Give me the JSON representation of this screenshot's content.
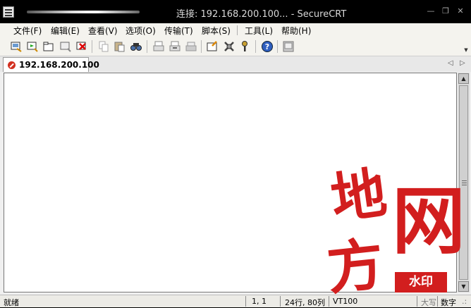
{
  "window": {
    "title": "连接: 192.168.200.100... - SecureCRT",
    "controls": [
      "minimize",
      "restore",
      "close"
    ]
  },
  "menu": [
    {
      "label": "文件(F)"
    },
    {
      "label": "编辑(E)"
    },
    {
      "label": "查看(V)"
    },
    {
      "label": "选项(O)"
    },
    {
      "label": "传输(T)"
    },
    {
      "label": "脚本(S)"
    },
    {
      "label": "工具(L)"
    },
    {
      "label": "帮助(H)"
    }
  ],
  "toolbar": {
    "buttons": [
      "connect-icon",
      "quick-connect-icon",
      "connect-in-tab-icon",
      "reconnect-icon",
      "disconnect-icon",
      "copy-icon",
      "paste-icon",
      "find-icon",
      "print-icon",
      "print-selection-icon",
      "printer-icon",
      "session-options-icon",
      "global-options-icon",
      "keymap-icon",
      "help-icon",
      "screenshot-icon"
    ]
  },
  "tabs": [
    {
      "label": "192.168.200.100",
      "status": "disconnected",
      "status_color": "#d23020"
    }
  ],
  "watermark": {
    "chars": [
      "地",
      "网",
      "方"
    ],
    "badge": "水印",
    "color": "#d21e1e"
  },
  "statusbar": {
    "ready": "就绪",
    "position": "1,  1",
    "size": "24行, 80列",
    "terminal": "VT100",
    "caps": "大写",
    "num": "数字"
  }
}
